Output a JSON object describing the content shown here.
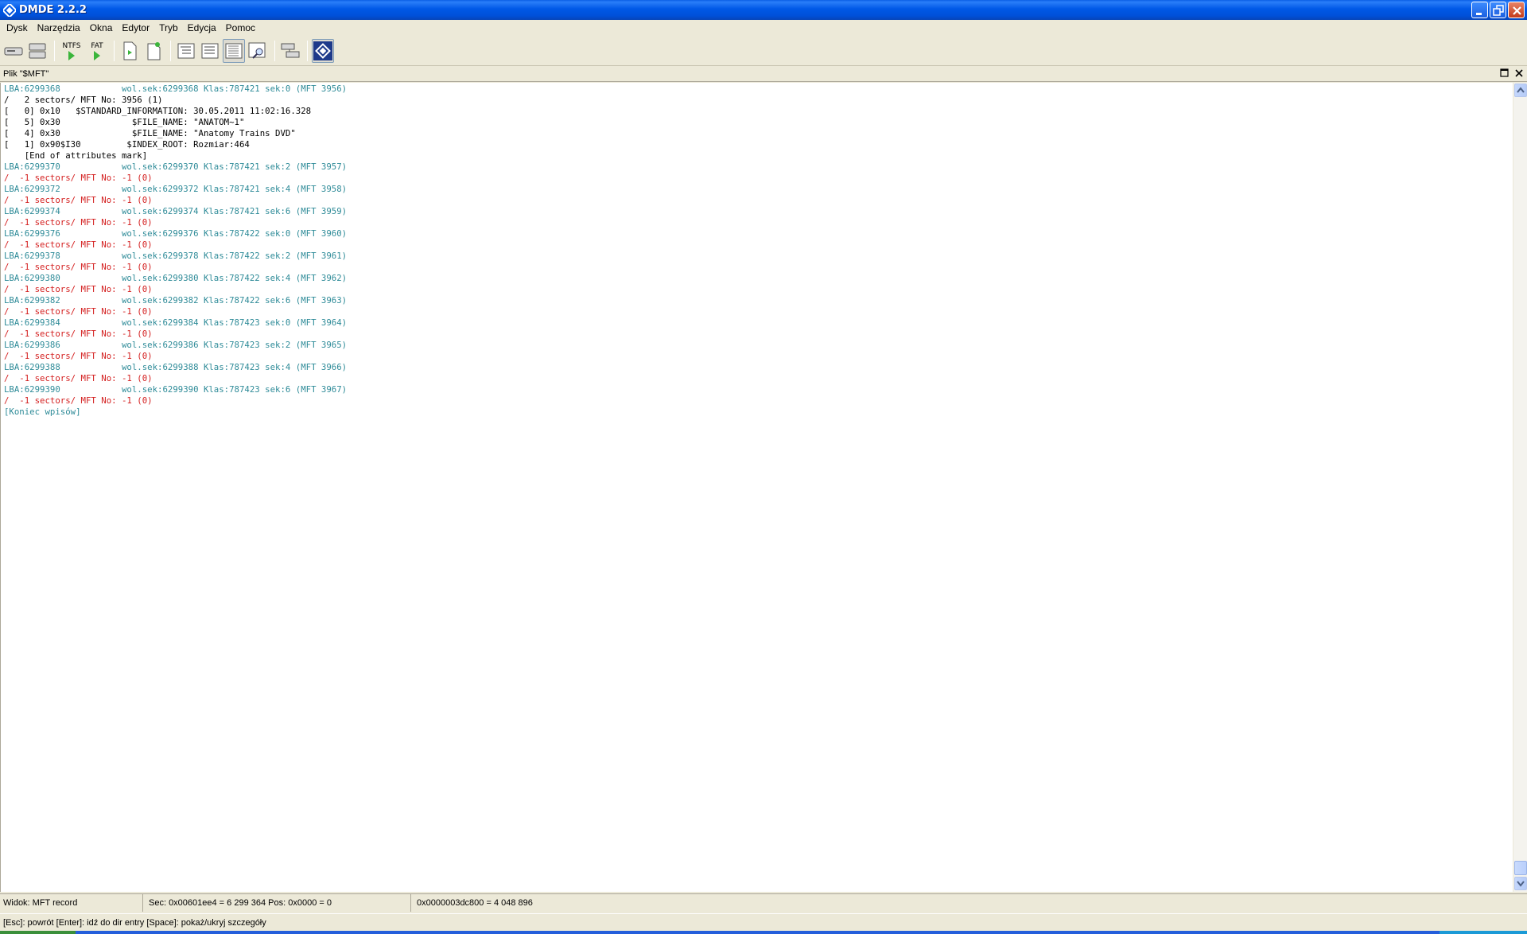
{
  "window": {
    "title": "DMDE 2.2.2"
  },
  "menu": [
    "Dysk",
    "Narzędzia",
    "Okna",
    "Edytor",
    "Tryb",
    "Edycja",
    "Pomoc"
  ],
  "toolbar": {
    "ntfs_label": "NTFS",
    "fat_label": "FAT"
  },
  "panel": {
    "title": "Plik \"$MFT\""
  },
  "content": {
    "lines": [
      {
        "text": "LBA:6299368            wol.sek:6299368 Klas:787421 sek:0 (MFT 3956)",
        "style": "lba"
      },
      {
        "text": "/   2 sectors/ MFT No: 3956 (1)",
        "style": "blk"
      },
      {
        "text": "[   0] 0x10   $STANDARD_INFORMATION: 30.05.2011 11:02:16.328",
        "style": "blk"
      },
      {
        "text": "[   5] 0x30              $FILE_NAME: \"ANATOM~1\"",
        "style": "blk"
      },
      {
        "text": "[   4] 0x30              $FILE_NAME: \"Anatomy Trains DVD\"",
        "style": "blk"
      },
      {
        "text": "[   1] 0x90$I30         $INDEX_ROOT: Rozmiar:464",
        "style": "blk"
      },
      {
        "text": "    [End of attributes mark]",
        "style": "blk"
      },
      {
        "text": "LBA:6299370            wol.sek:6299370 Klas:787421 sek:2 (MFT 3957)",
        "style": "lba"
      },
      {
        "text": "/  -1 sectors/ MFT No: -1 (0)",
        "style": "red"
      },
      {
        "text": "LBA:6299372            wol.sek:6299372 Klas:787421 sek:4 (MFT 3958)",
        "style": "lba"
      },
      {
        "text": "/  -1 sectors/ MFT No: -1 (0)",
        "style": "red"
      },
      {
        "text": "LBA:6299374            wol.sek:6299374 Klas:787421 sek:6 (MFT 3959)",
        "style": "lba"
      },
      {
        "text": "/  -1 sectors/ MFT No: -1 (0)",
        "style": "red"
      },
      {
        "text": "LBA:6299376            wol.sek:6299376 Klas:787422 sek:0 (MFT 3960)",
        "style": "lba"
      },
      {
        "text": "/  -1 sectors/ MFT No: -1 (0)",
        "style": "red"
      },
      {
        "text": "LBA:6299378            wol.sek:6299378 Klas:787422 sek:2 (MFT 3961)",
        "style": "lba"
      },
      {
        "text": "/  -1 sectors/ MFT No: -1 (0)",
        "style": "red"
      },
      {
        "text": "LBA:6299380            wol.sek:6299380 Klas:787422 sek:4 (MFT 3962)",
        "style": "lba"
      },
      {
        "text": "/  -1 sectors/ MFT No: -1 (0)",
        "style": "red"
      },
      {
        "text": "LBA:6299382            wol.sek:6299382 Klas:787422 sek:6 (MFT 3963)",
        "style": "lba"
      },
      {
        "text": "/  -1 sectors/ MFT No: -1 (0)",
        "style": "red"
      },
      {
        "text": "LBA:6299384            wol.sek:6299384 Klas:787423 sek:0 (MFT 3964)",
        "style": "lba"
      },
      {
        "text": "/  -1 sectors/ MFT No: -1 (0)",
        "style": "red"
      },
      {
        "text": "LBA:6299386            wol.sek:6299386 Klas:787423 sek:2 (MFT 3965)",
        "style": "lba"
      },
      {
        "text": "/  -1 sectors/ MFT No: -1 (0)",
        "style": "red"
      },
      {
        "text": "LBA:6299388            wol.sek:6299388 Klas:787423 sek:4 (MFT 3966)",
        "style": "lba"
      },
      {
        "text": "/  -1 sectors/ MFT No: -1 (0)",
        "style": "red"
      },
      {
        "text": "LBA:6299390            wol.sek:6299390 Klas:787423 sek:6 (MFT 3967)",
        "style": "lba"
      },
      {
        "text": "/  -1 sectors/ MFT No: -1 (0)",
        "style": "red"
      },
      {
        "text": "[Koniec wpisów]",
        "style": "end"
      }
    ]
  },
  "status": {
    "view": "Widok: MFT record",
    "sector": "Sec: 0x00601ee4 = 6 299 364  Pos: 0x0000 = 0",
    "offset": "0x0000003dc800 = 4 048 896"
  },
  "hints": "[Esc]: powrót  [Enter]: idź do dir entry  [Space]: pokaż/ukryj szczegóły",
  "colors": {
    "lba": "#2e8b98",
    "red": "#d42020",
    "titlebar": "#0058e6"
  }
}
